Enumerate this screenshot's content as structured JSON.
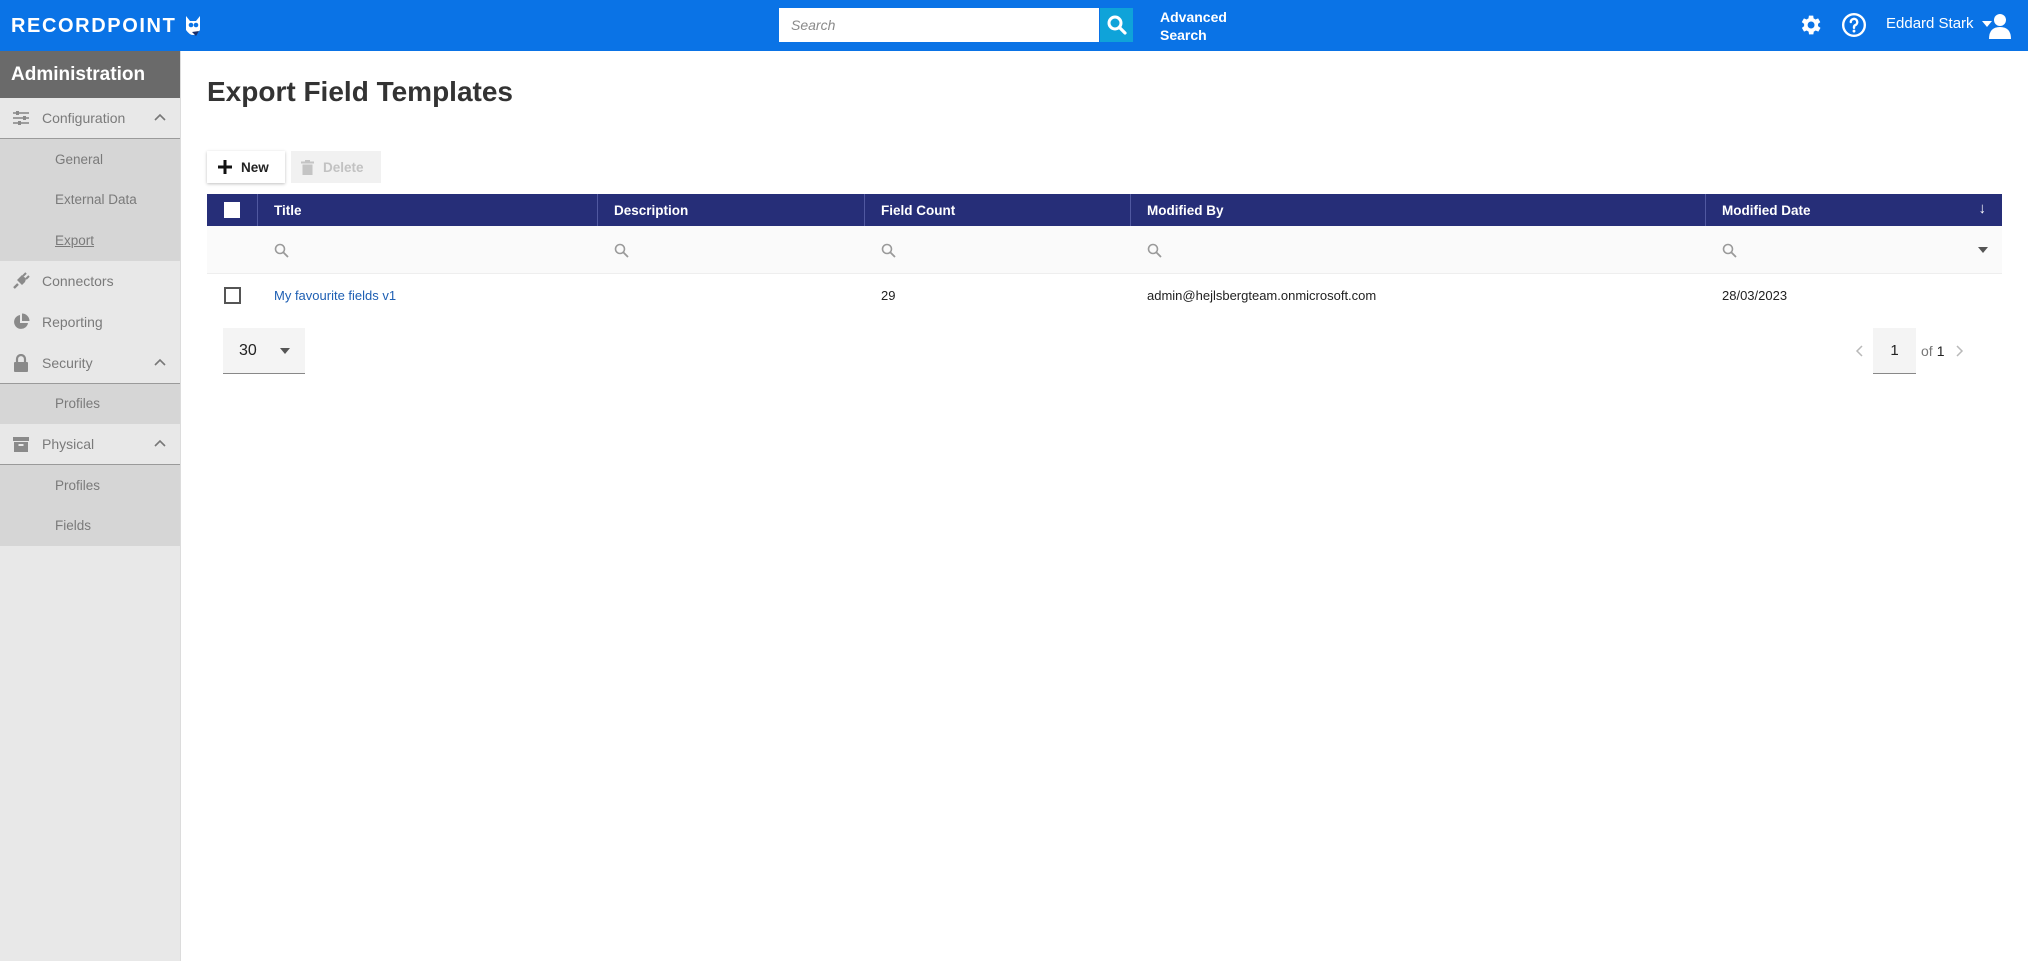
{
  "brand": {
    "logo_text": "RECORDPOINT"
  },
  "header": {
    "search_placeholder": "Search",
    "advanced_search_line1": "Advanced",
    "advanced_search_line2": "Search",
    "user_name": "Eddard Stark"
  },
  "sidebar": {
    "title": "Administration",
    "configuration": {
      "label": "Configuration",
      "items": [
        "General",
        "External Data",
        "Export"
      ]
    },
    "connectors": {
      "label": "Connectors"
    },
    "reporting": {
      "label": "Reporting"
    },
    "security": {
      "label": "Security",
      "items": [
        "Profiles"
      ]
    },
    "physical": {
      "label": "Physical",
      "items": [
        "Profiles",
        "Fields"
      ]
    }
  },
  "page": {
    "title": "Export Field Templates"
  },
  "toolbar": {
    "new_label": "New",
    "delete_label": "Delete"
  },
  "grid": {
    "columns": [
      "Title",
      "Description",
      "Field Count",
      "Modified By",
      "Modified Date"
    ],
    "sort_indicator": "↓",
    "rows": [
      {
        "title": "My favourite fields v1",
        "description": "",
        "field_count": "29",
        "modified_by": "admin@hejlsbergteam.onmicrosoft.com",
        "modified_date": "28/03/2023"
      }
    ]
  },
  "pagination": {
    "page_size": "30",
    "current_page": "1",
    "of_label": "of",
    "total_pages": "1"
  },
  "colors": {
    "topbar": "#0a73e6",
    "search_button": "#0fa3d9",
    "grid_header": "#262e78",
    "sidebar_header": "#6a6a6a",
    "link": "#1e5fb3"
  }
}
